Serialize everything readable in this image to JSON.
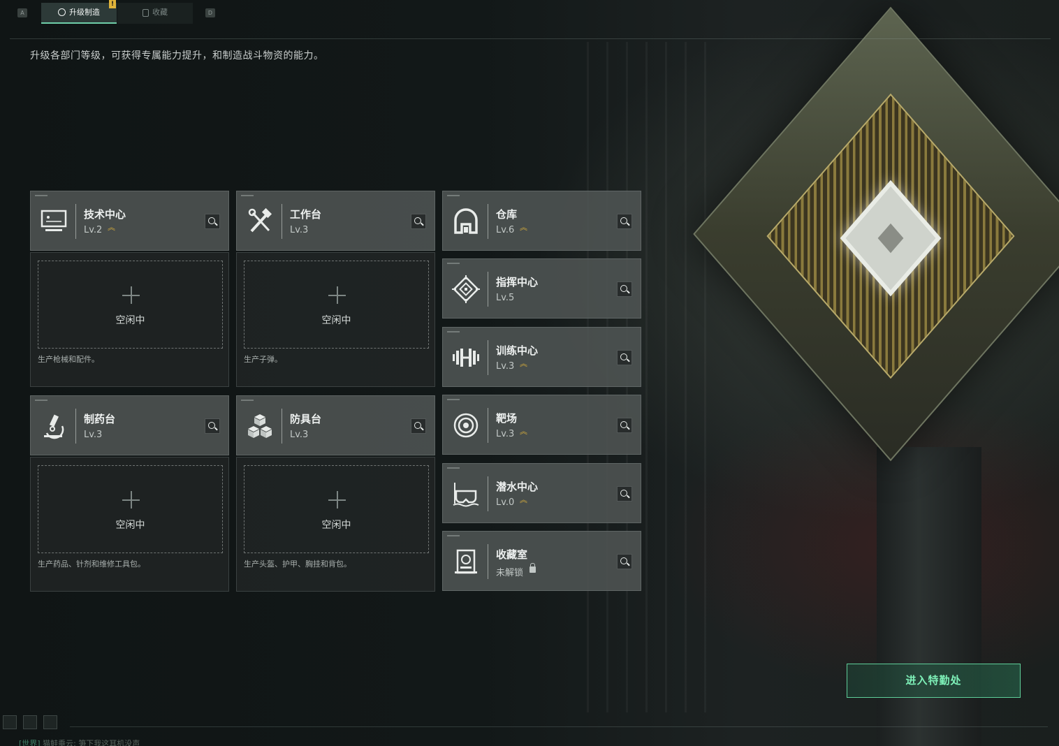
{
  "tabs": {
    "left_key": "A",
    "right_key": "D",
    "active": {
      "label": "升级制造",
      "badge": "!"
    },
    "idle": {
      "label": "收藏"
    }
  },
  "subtitle": "升级各部门等级，可获得专属能力提升，和制造战斗物资的能力。",
  "production": [
    {
      "name": "技术中心",
      "level": "Lv.2",
      "upgradable": true,
      "icon": "monitor-icon",
      "slot": "空闲中",
      "desc": "生产枪械和配件。"
    },
    {
      "name": "工作台",
      "level": "Lv.3",
      "upgradable": false,
      "icon": "hammer-wrench-icon",
      "slot": "空闲中",
      "desc": "生产子弹。"
    },
    {
      "name": "制药台",
      "level": "Lv.3",
      "upgradable": false,
      "icon": "microscope-icon",
      "slot": "空闲中",
      "desc": "生产药品、针剂和维修工具包。"
    },
    {
      "name": "防具台",
      "level": "Lv.3",
      "upgradable": false,
      "icon": "cubes-icon",
      "slot": "空闲中",
      "desc": "生产头盔、护甲、胸挂和背包。"
    }
  ],
  "departments": [
    {
      "name": "仓库",
      "level": "Lv.6",
      "upgradable": true,
      "icon": "warehouse-icon"
    },
    {
      "name": "指挥中心",
      "level": "Lv.5",
      "upgradable": false,
      "icon": "chip-icon"
    },
    {
      "name": "训练中心",
      "level": "Lv.3",
      "upgradable": true,
      "icon": "dumbbell-icon"
    },
    {
      "name": "靶场",
      "level": "Lv.3",
      "upgradable": true,
      "icon": "target-icon"
    },
    {
      "name": "潜水中心",
      "level": "Lv.0",
      "upgradable": true,
      "icon": "diving-mask-icon"
    },
    {
      "name": "收藏室",
      "level": "未解锁",
      "locked": true,
      "icon": "collection-icon"
    }
  ],
  "enter_button": "进入特勤处",
  "chat": {
    "channel": "[世界]",
    "user": "猫鲑垂云:",
    "message": "笋下我这耳机没声"
  },
  "colors": {
    "accent": "#6fcfa9",
    "upgrade": "#e0b33a",
    "button_text": "#7ef0b8"
  }
}
